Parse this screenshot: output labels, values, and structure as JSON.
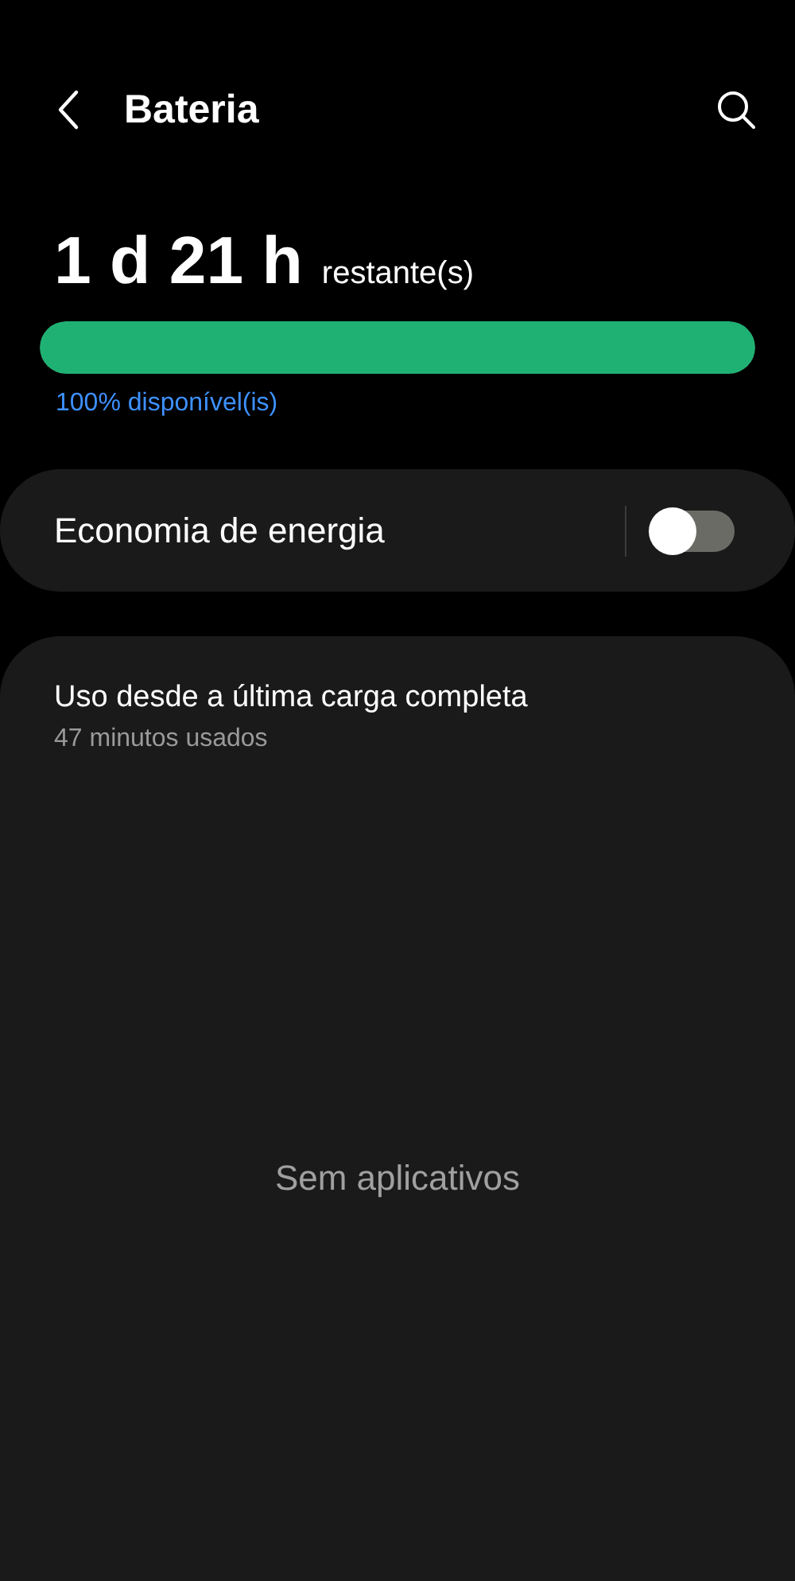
{
  "header": {
    "title": "Bateria"
  },
  "battery": {
    "time_value": "1 d 21 h",
    "time_suffix": "restante(s)",
    "level": 1.0,
    "available": "100% disponível(is)"
  },
  "power_saving": {
    "label": "Economia de energia",
    "on": false
  },
  "usage": {
    "title": "Uso desde a última carga completa",
    "subtitle": "47 minutos usados",
    "empty_text": "Sem aplicativos"
  }
}
